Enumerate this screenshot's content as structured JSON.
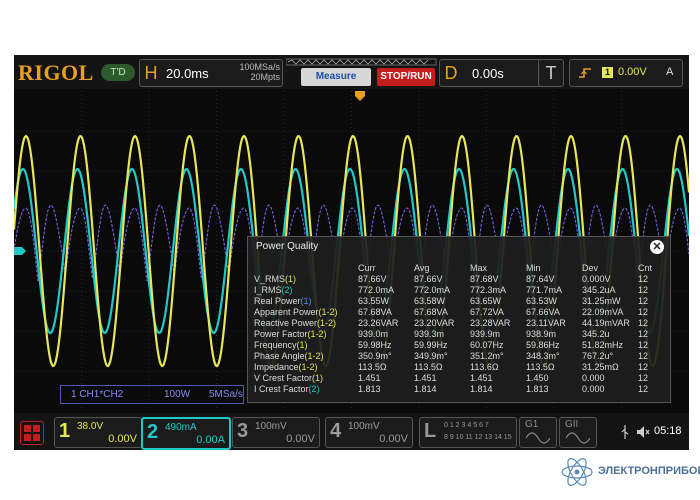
{
  "header": {
    "brand": "RIGOL",
    "td_badge": "T'D",
    "horizontal": {
      "letter": "H",
      "timebase": "20.0ms",
      "sample_rate": "100MSa/s",
      "memory_depth": "20Mpts"
    },
    "measure_label": "Measure",
    "stop_run_label": "STOP/RUN",
    "delay": {
      "letter": "D",
      "value": "0.00s"
    },
    "trigger": {
      "letter": "T",
      "source": "1",
      "level": "0.00V",
      "mode": "A"
    }
  },
  "waveform": {
    "ch1_color": "#e6e65a",
    "ch2_color": "#22c8c8",
    "math_color": "#7a5ce0"
  },
  "power_quality": {
    "title": "Power Quality",
    "columns": [
      "",
      "Curr",
      "Avg",
      "Max",
      "Min",
      "Dev",
      "Cnt"
    ],
    "rows": [
      {
        "name": "V_RMS",
        "tag": "(1)",
        "tag_color": "#e6e65a",
        "vals": [
          "87.66V",
          "87.66V",
          "87.68V",
          "87.64V",
          "0.000V",
          "12"
        ]
      },
      {
        "name": "I_RMS",
        "tag": "(2)",
        "tag_color": "#22c8c8",
        "vals": [
          "772.0mA",
          "772.0mA",
          "772.3mA",
          "771.7mA",
          "345.2uA",
          "12"
        ]
      },
      {
        "name": "Real Power",
        "tag": "(1)",
        "tag_color": "#4f8fe8",
        "vals": [
          "63.55W",
          "63.58W",
          "63.65W",
          "63.53W",
          "31.25mW",
          "12"
        ]
      },
      {
        "name": "Apparent Power",
        "tag": "(1-2)",
        "tag_color": "#e6e65a",
        "vals": [
          "67.68VA",
          "67.68VA",
          "67.72VA",
          "67.66VA",
          "22.09mVA",
          "12"
        ]
      },
      {
        "name": "Reactive Power",
        "tag": "(1-2)",
        "tag_color": "#e6e65a",
        "vals": [
          "23.26VAR",
          "23.20VAR",
          "23.28VAR",
          "23.11VAR",
          "44.19mVAR",
          "12"
        ]
      },
      {
        "name": "Power Factor",
        "tag": "(1-2)",
        "tag_color": "#e6e65a",
        "vals": [
          "939.0m",
          "939.3m",
          "939.9m",
          "938.9m",
          "345.2u",
          "12"
        ]
      },
      {
        "name": "Frequency",
        "tag": "(1)",
        "tag_color": "#e6e65a",
        "vals": [
          "59.98Hz",
          "59.99Hz",
          "60.07Hz",
          "59.86Hz",
          "51.82mHz",
          "12"
        ]
      },
      {
        "name": "Phase Angle",
        "tag": "(1-2)",
        "tag_color": "#e6e65a",
        "vals": [
          "350.9m°",
          "349.9m°",
          "351.2m°",
          "348.3m°",
          "767.2u°",
          "12"
        ]
      },
      {
        "name": "Impedance",
        "tag": "(1-2)",
        "tag_color": "#e6e65a",
        "vals": [
          "113.5Ω",
          "113.5Ω",
          "113.6Ω",
          "113.5Ω",
          "31.25mΩ",
          "12"
        ]
      },
      {
        "name": "V Crest Factor",
        "tag": "(1)",
        "tag_color": "#e6e65a",
        "vals": [
          "1.451",
          "1.451",
          "1.451",
          "1.450",
          "0.000",
          "12"
        ]
      },
      {
        "name": "I Crest Factor",
        "tag": "(2)",
        "tag_color": "#22c8c8",
        "vals": [
          "1.813",
          "1.814",
          "1.814",
          "1.813",
          "0.000",
          "12"
        ]
      }
    ]
  },
  "math_info": {
    "source": "1 CH1*CH2",
    "scale": "100W",
    "rate": "5MSa/s"
  },
  "channels": [
    {
      "num": "1",
      "scale": "38.0V",
      "offset": "0.00V",
      "color": "#e6e65a"
    },
    {
      "num": "2",
      "scale": "490mA",
      "offset": "0.00A",
      "color": "#22c8c8"
    },
    {
      "num": "3",
      "scale": "100mV",
      "offset": "0.00V",
      "color": "#9a9a9a"
    },
    {
      "num": "4",
      "scale": "100mV",
      "offset": "0.00V",
      "color": "#9a9a9a"
    }
  ],
  "logic": {
    "letter": "L",
    "row1": "0 1 2 3 4 5 6 7",
    "row2": "8 9 10 11 12 13 14 15"
  },
  "gen1": "G1",
  "gen2": "GII",
  "clock": "05:18",
  "watermark": "ЭЛЕКТРОНПРИБОР"
}
